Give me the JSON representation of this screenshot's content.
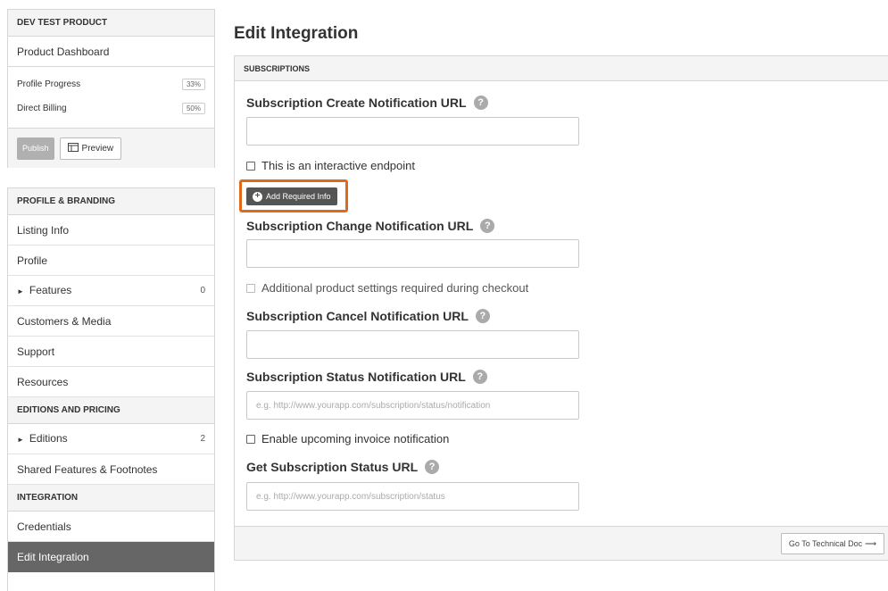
{
  "sidebar_top": {
    "product_name": "DEV TEST PRODUCT",
    "dashboard_label": "Product Dashboard",
    "progress": [
      {
        "label": "Profile Progress",
        "value": "33%"
      },
      {
        "label": "Direct Billing",
        "value": "50%"
      }
    ],
    "publish_label": "Publish",
    "preview_label": "Preview"
  },
  "sidebar_nav": {
    "profile_heading": "PROFILE & BRANDING",
    "listing_info": "Listing Info",
    "profile": "Profile",
    "features": "Features",
    "features_count": "0",
    "customers_media": "Customers & Media",
    "support": "Support",
    "resources": "Resources",
    "editions_heading": "EDITIONS AND PRICING",
    "editions": "Editions",
    "editions_count": "2",
    "shared_features": "Shared Features & Footnotes",
    "integration_heading": "INTEGRATION",
    "credentials": "Credentials",
    "edit_integration": "Edit Integration"
  },
  "main": {
    "title": "Edit Integration",
    "section_heading": "SUBSCRIPTIONS",
    "create_label": "Subscription Create Notification URL",
    "create_value": "",
    "interactive_label": "This is an interactive endpoint",
    "add_required_label": "Add Required Info",
    "change_label": "Subscription Change Notification URL",
    "change_value": "",
    "additional_label": "Additional product settings required during checkout",
    "cancel_label": "Subscription Cancel Notification URL",
    "cancel_value": "",
    "status_label": "Subscription Status Notification URL",
    "status_placeholder": "e.g. http://www.yourapp.com/subscription/status/notification",
    "upcoming_label": "Enable upcoming invoice notification",
    "get_status_label": "Get Subscription Status URL",
    "get_status_placeholder": "e.g. http://www.yourapp.com/subscription/status",
    "tech_doc_label": "Go To Technical Doc",
    "help_glyph": "?"
  },
  "colors": {
    "highlight": "#e06a1a",
    "active_nav": "#666666",
    "button_dark": "#555555"
  }
}
